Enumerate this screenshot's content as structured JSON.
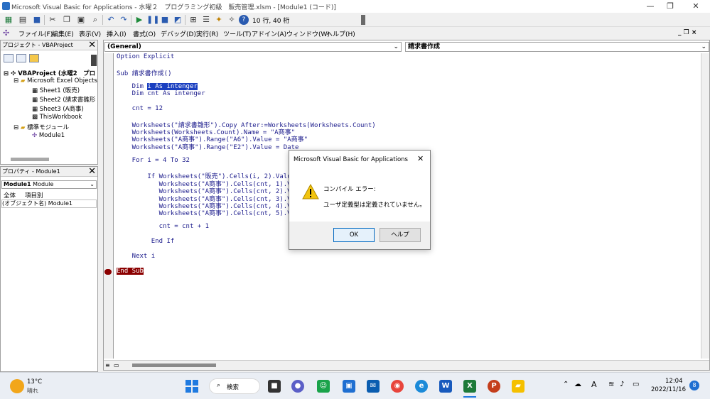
{
  "window": {
    "title": "Microsoft Visual Basic for Applications - 水曜２　プログラミング初級　販売管理.xlsm - [Module1 (コード)]",
    "controls": [
      "—",
      "❐",
      "✕"
    ]
  },
  "toolbar": {
    "position": "10 行, 40 桁",
    "icons": [
      "excel-icon",
      "insert-icon",
      "save-icon",
      "cut-icon",
      "copy-icon",
      "paste-icon",
      "find-icon",
      "undo-icon",
      "redo-icon",
      "run-icon",
      "pause-icon",
      "stop-icon",
      "design-mode-icon",
      "project-explorer-icon",
      "properties-icon",
      "object-browser-icon",
      "toolbox-icon",
      "help-icon"
    ]
  },
  "menubar": {
    "items": [
      "ファイル(F)",
      "編集(E)",
      "表示(V)",
      "挿入(I)",
      "書式(O)",
      "デバッグ(D)",
      "実行(R)",
      "ツール(T)",
      "アドイン(A)",
      "ウィンドウ(W)",
      "ヘルプ(H)"
    ],
    "right_controls": "_ ❐ ×"
  },
  "project_pane": {
    "title": "プロジェクト - VBAProject",
    "close": "✕",
    "tree": [
      {
        "label": "VBAProject (水曜2　プロ",
        "level": 0
      },
      {
        "label": "Microsoft Excel Objects",
        "level": 1
      },
      {
        "label": "Sheet1 (販売)",
        "level": 2
      },
      {
        "label": "Sheet2 (請求書雛形",
        "level": 2
      },
      {
        "label": "Sheet3 (A商事)",
        "level": 2
      },
      {
        "label": "ThisWorkbook",
        "level": 2
      },
      {
        "label": "標準モジュール",
        "level": 1
      },
      {
        "label": "Module1",
        "level": 2
      }
    ]
  },
  "properties_pane": {
    "title": "プロパティ - Module1",
    "close": "✕",
    "object_combo": "Module1",
    "object_type": "Module",
    "tabs": [
      "全体",
      "項目別"
    ],
    "row_name": "(オブジェクト名)",
    "row_value": "Module1"
  },
  "code_window": {
    "object_combo": "(General)",
    "proc_combo": "請求書作成",
    "lines": [
      "Option Explicit",
      "",
      "Sub 請求書作成()",
      "",
      "    Dim i As intenger",
      "    Dim cnt As intenger",
      "",
      "    cnt = 12",
      "",
      "    Worksheets(\"請求書雛形\").Copy After:=Worksheets(Worksheets.Count)",
      "    Worksheets(Worksheets.Count).Name = \"A商事\"",
      "    Worksheets(\"A商事\").Range(\"A6\").Value = \"A商事\"",
      "    Worksheets(\"A商事\").Range(\"E2\").Value = Date",
      "",
      "    For i = 4 To 32",
      "",
      "        If Worksheets(\"販売\").Cells(i, 2).Value",
      "           Worksheets(\"A商事\").Cells(cnt, 1).Va                           alue",
      "           Worksheets(\"A商事\").Cells(cnt, 2).Va                           alue",
      "           Worksheets(\"A商事\").Cells(cnt, 3).Va                           alue",
      "           Worksheets(\"A商事\").Cells(cnt, 4).Va                           alue",
      "           Worksheets(\"A商事\").Cells(cnt, 5).Va                           alue",
      "",
      "           cnt = cnt + 1",
      "",
      "         End If",
      "",
      "    Next i",
      "",
      "End Sub"
    ]
  },
  "dialog": {
    "title": "Microsoft Visual Basic for Applications",
    "close": "✕",
    "heading": "コンパイル エラー:",
    "message": "ユーザ定義型は定義されていません。",
    "ok": "OK",
    "help": "ヘルプ"
  },
  "taskbar": {
    "weather_temp": "13°C",
    "weather_desc": "晴れ",
    "search": "検索",
    "time": "12:04",
    "date": "2022/11/16",
    "notifications": "8",
    "ime": "A"
  },
  "colors": {
    "code_text": "#1c1c8c",
    "selection": "#1a3fc0",
    "breakpoint": "#8b0000",
    "dialog_warning": "#f2c40f"
  }
}
